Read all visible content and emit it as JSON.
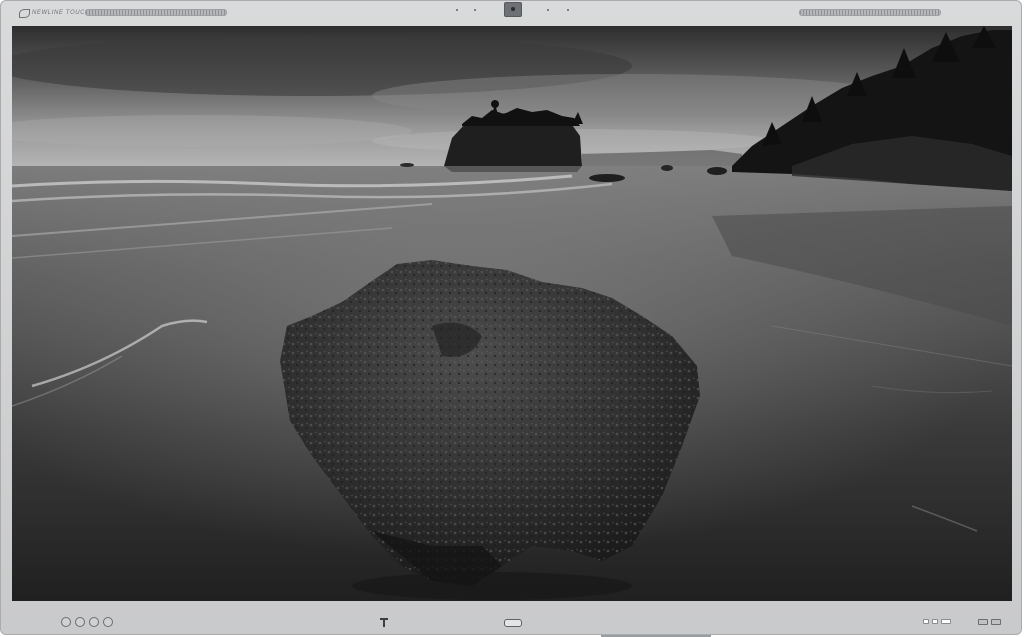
{
  "device": {
    "brand_text": "NEWLINE TOUCH",
    "icons": {
      "camera": "webcam-icon",
      "brand": "brand-logo-icon",
      "home": "home-button-icon",
      "menu": "brand-t-logo-icon"
    }
  },
  "screen": {
    "content": "coastal-seascape-photo",
    "tone": "monochrome"
  },
  "colors": {
    "bezel": "#d2d3d4",
    "bezel_border": "#a9abad",
    "screen_dark": "#2a2a2a",
    "sky_light": "#9b9b9b"
  }
}
